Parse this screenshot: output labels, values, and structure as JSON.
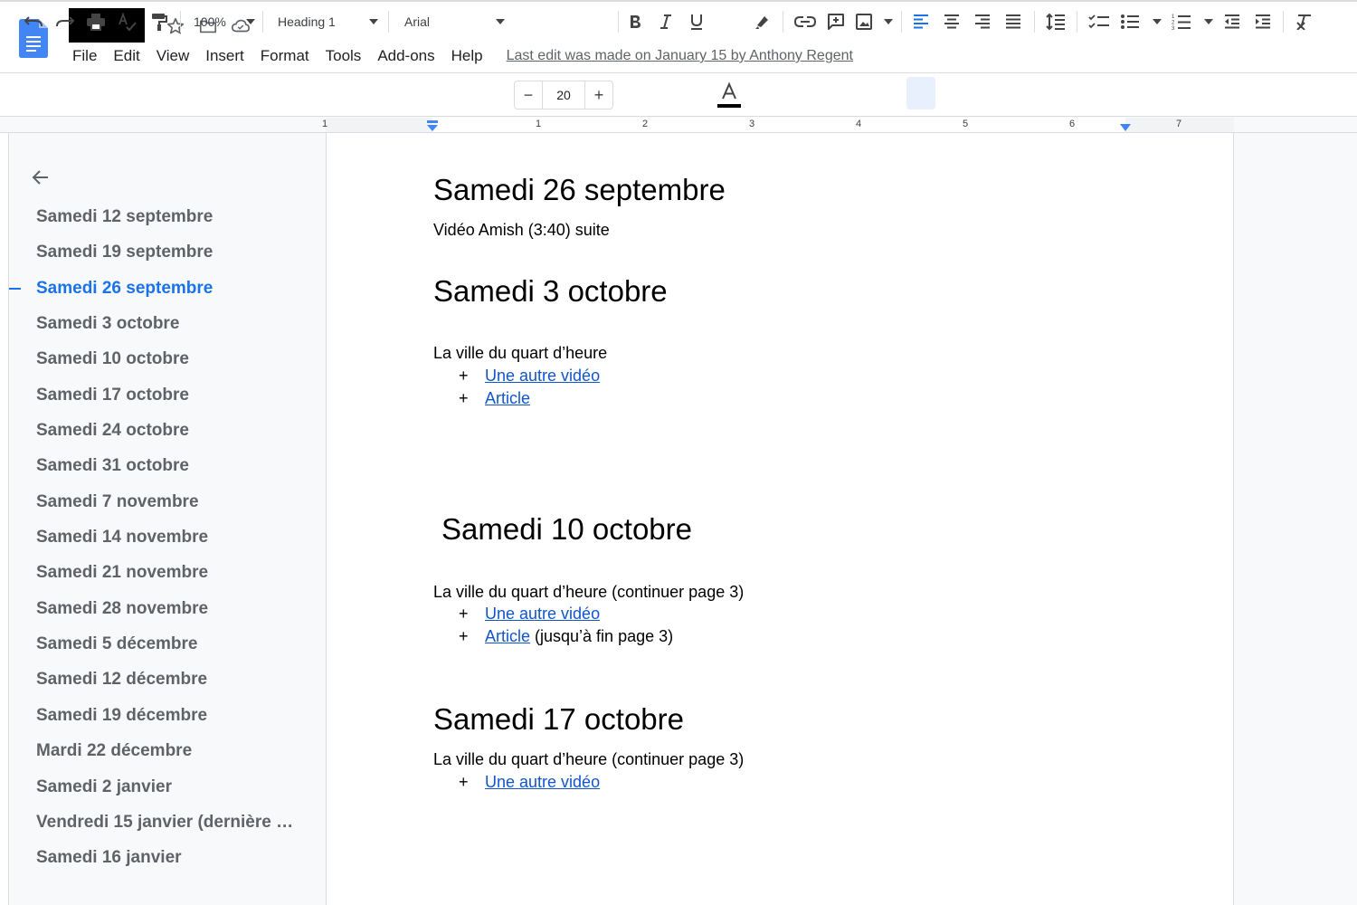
{
  "menu": [
    "File",
    "Edit",
    "View",
    "Insert",
    "Format",
    "Tools",
    "Add-ons",
    "Help"
  ],
  "last_edit": "Last edit was made on January 15 by Anthony Regent",
  "toolbar": {
    "zoom": "100%",
    "style": "Heading 1",
    "font": "Arial",
    "font_size": "20",
    "minus": "−",
    "plus": "+"
  },
  "ruler": [
    "1",
    "1",
    "2",
    "3",
    "4",
    "5",
    "6",
    "7"
  ],
  "outline": [
    "Samedi 12 septembre",
    "Samedi 19 septembre",
    "Samedi 26 septembre",
    "Samedi 3 octobre",
    "Samedi 10 octobre",
    "Samedi 17 octobre",
    "Samedi 24 octobre",
    "Samedi 31 octobre",
    "Samedi 7 novembre",
    "Samedi 14 novembre",
    "Samedi 21 novembre",
    "Samedi 28 novembre",
    "Samedi 5 décembre",
    "Samedi 12 décembre",
    "Samedi 19 décembre",
    "Mardi 22 décembre",
    "Samedi 2 janvier",
    "Vendredi 15 janvier (dernière …",
    "Samedi 16 janvier"
  ],
  "outline_active_index": 2,
  "document": {
    "s1_heading": "Samedi 26 septembre",
    "s1_text": "Vidéo Amish (3:40) suite",
    "s2_heading": "Samedi 3 octobre",
    "s2_text": "La ville du quart d’heure",
    "s2_link1": "Une autre vidéo",
    "s2_link2": "Article",
    "s3_heading": "Samedi 10 octobre",
    "s3_text": "La ville du quart d’heure (continuer page 3)",
    "s3_link1": "Une autre vidéo",
    "s3_link2": "Article",
    "s3_link2_suffix": " (jusqu’à fin page 3)",
    "s4_heading": "Samedi 17 octobre",
    "s4_text": "La ville du quart d’heure (continuer page 3)",
    "s4_link1": "Une autre vidéo",
    "bullet": "+"
  },
  "colors": {
    "accent": "#1a73e8",
    "link": "#1155cc",
    "outline_text": "#5f6368"
  }
}
